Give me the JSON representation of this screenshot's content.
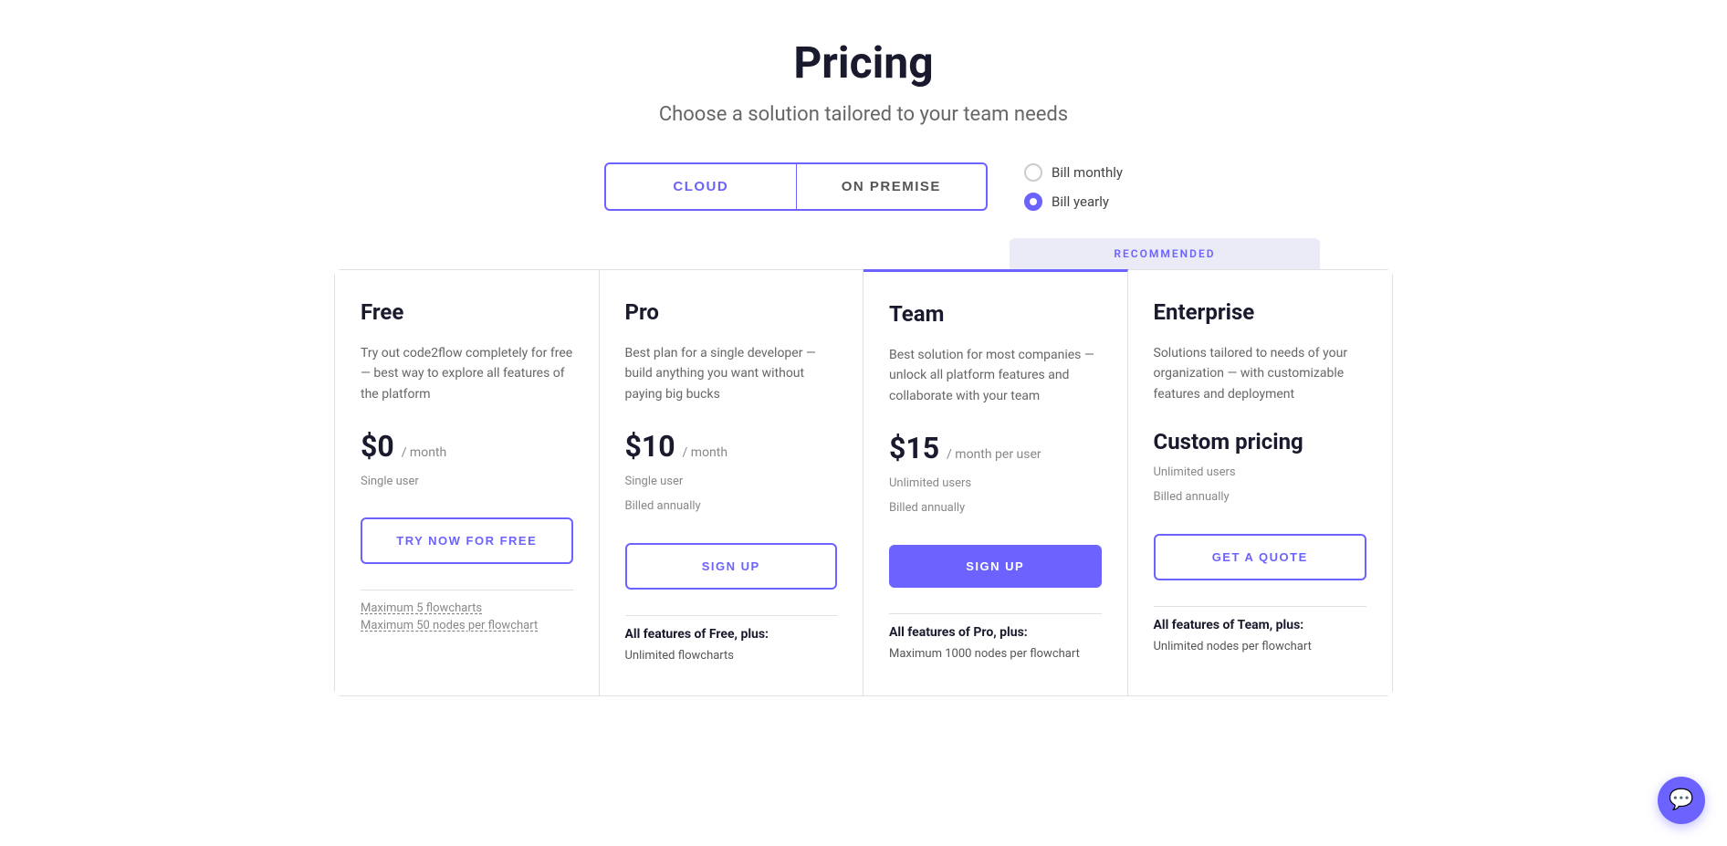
{
  "page": {
    "title": "Pricing",
    "subtitle": "Choose a solution tailored to your team needs"
  },
  "planToggle": {
    "cloud_label": "CLOUD",
    "on_premise_label": "ON PREMISE",
    "active": "cloud"
  },
  "billing": {
    "monthly_label": "Bill monthly",
    "yearly_label": "Bill yearly",
    "selected": "yearly"
  },
  "recommended_label": "RECOMMENDED",
  "plans": [
    {
      "id": "free",
      "name": "Free",
      "description": "Try out code2flow completely for free — best way to explore all features of the platform",
      "price": "$0",
      "period": "/ month",
      "per_user": "",
      "user_line1": "Single user",
      "user_line2": "",
      "cta_label": "TRY NOW FOR FREE",
      "cta_type": "outline",
      "features_header": "",
      "features": [
        "Maximum 5 flowcharts",
        "Maximum 50 nodes per flowchart"
      ],
      "recommended": false
    },
    {
      "id": "pro",
      "name": "Pro",
      "description": "Best plan for a single developer — build anything you want without paying big bucks",
      "price": "$10",
      "period": "/ month",
      "per_user": "",
      "user_line1": "Single user",
      "user_line2": "Billed annually",
      "cta_label": "SIGN UP",
      "cta_type": "outline",
      "features_header": "All features of Free, plus:",
      "features": [
        "Unlimited flowcharts"
      ],
      "recommended": false
    },
    {
      "id": "team",
      "name": "Team",
      "description": "Best solution for most companies — unlock all platform features and collaborate with your team",
      "price": "$15",
      "period": "/ month per user",
      "per_user": "",
      "user_line1": "Unlimited users",
      "user_line2": "Billed annually",
      "cta_label": "SIGN UP",
      "cta_type": "solid",
      "features_header": "All features of Pro, plus:",
      "features": [
        "Maximum 1000 nodes per flowchart"
      ],
      "recommended": true
    },
    {
      "id": "enterprise",
      "name": "Enterprise",
      "description": "Solutions tailored to needs of your organization — with customizable features and deployment",
      "price": "Custom pricing",
      "period": "",
      "per_user": "",
      "user_line1": "Unlimited users",
      "user_line2": "Billed annually",
      "cta_label": "GET A QUOTE",
      "cta_type": "outline",
      "features_header": "All features of Team, plus:",
      "features": [
        "Unlimited nodes per flowchart"
      ],
      "recommended": false
    }
  ]
}
